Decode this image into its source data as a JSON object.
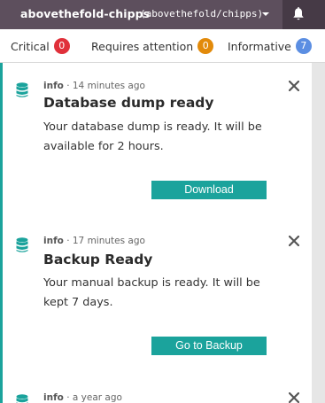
{
  "header": {
    "project_name": "abovethefold-chipps",
    "project_id": "(abovethefold/chipps)",
    "colors": {
      "topbar": "#5d4f5d",
      "bell_area": "#463a46"
    }
  },
  "filters": {
    "critical": {
      "label": "Critical",
      "count": "0",
      "color": "#e0303a"
    },
    "attention": {
      "label": "Requires attention",
      "count": "0",
      "color": "#e28a0a"
    },
    "informative": {
      "label": "Informative",
      "count": "7",
      "color": "#5b8ee2"
    }
  },
  "notifications": [
    {
      "icon": "database-icon",
      "level": "info",
      "time": "· 14 minutes ago",
      "title": "Database dump ready",
      "message": "Your database dump is ready. It will be available for 2 hours.",
      "action": "Download"
    },
    {
      "icon": "database-icon",
      "level": "info",
      "time": "· 17 minutes ago",
      "title": "Backup Ready",
      "message": "Your manual backup is ready. It will be kept 7 days.",
      "action": "Go to Backup"
    },
    {
      "icon": "database-icon",
      "level": "info",
      "time": "· a year ago"
    }
  ],
  "accent_color": "#1ba39c"
}
